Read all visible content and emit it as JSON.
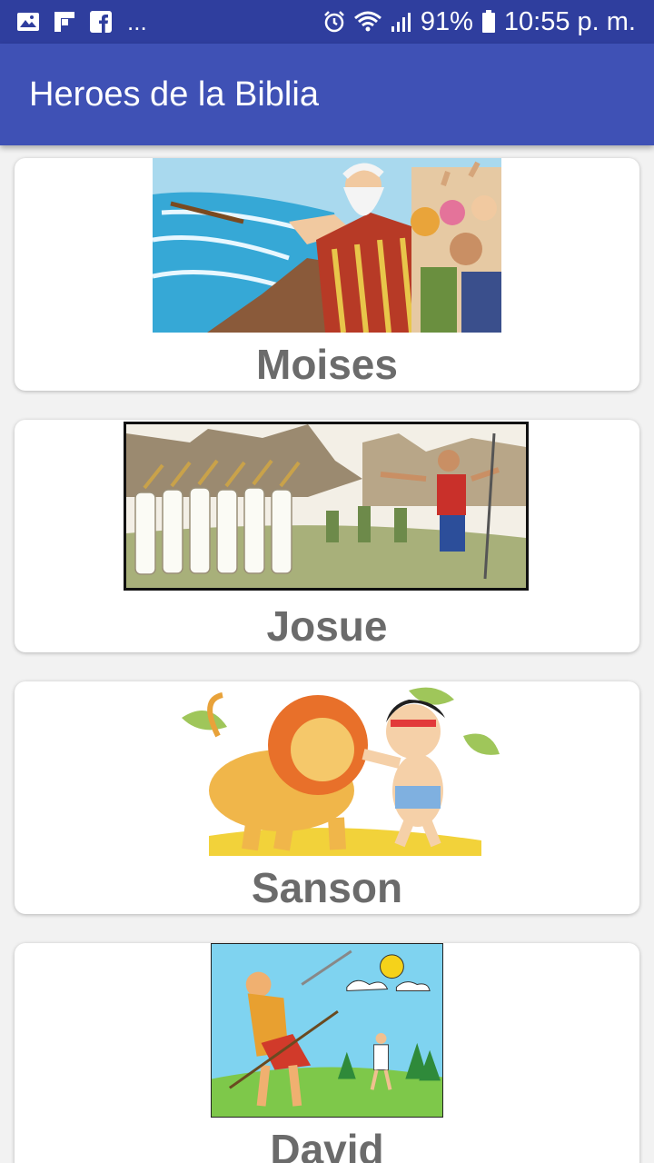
{
  "status_bar": {
    "notif_icons": [
      "image-icon",
      "flipboard-icon",
      "facebook-icon"
    ],
    "overflow": "...",
    "battery": "91%",
    "time": "10:55 p. m."
  },
  "app_bar": {
    "title": "Heroes de la Biblia"
  },
  "heroes": [
    {
      "name": "Moises",
      "image": "moses-parting-sea-image"
    },
    {
      "name": "Josue",
      "image": "jericho-walls-image"
    },
    {
      "name": "Sanson",
      "image": "samson-lion-image"
    },
    {
      "name": "David",
      "image": "david-goliath-image"
    }
  ],
  "colors": {
    "status_bar": "#2f3e9e",
    "app_bar": "#3f51b5",
    "label": "#6b6b6b"
  }
}
